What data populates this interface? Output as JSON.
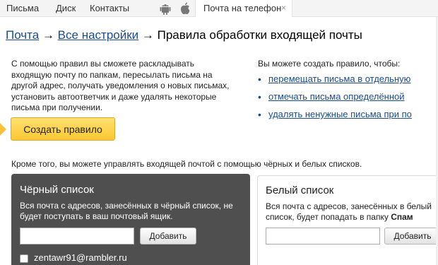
{
  "topnav": {
    "mail": "Письма",
    "disk": "Диск",
    "contacts": "Контакты",
    "phone_tab": "Почта на телефон",
    "close_glyph": "×",
    "icons": [
      "android-icon",
      "apple-icon"
    ]
  },
  "breadcrumb": {
    "mail": "Почта",
    "sep1": " → ",
    "settings": "Все настройки",
    "sep2": " → ",
    "current": "Правила обработки входящей почты"
  },
  "left_desc": "С помощью правил вы сможете раскладывать входящую почту по папкам, пересылать письма на другой адрес, получать уведомления о новых письмах, установить автоответчик и даже удалять некоторые письма при получении.",
  "create_rule_button": "Создать правило",
  "right_intro": "Вы можете создать правило, чтобы:",
  "rule_examples": [
    "перемещать письма в отдельную",
    "отмечать письма определённой",
    "удалять ненужные письма при по"
  ],
  "lists_intro": "Кроме того, вы можете управлять входящей почтой с помощью чёрных и белых списков.",
  "black_list": {
    "title": "Чёрный список",
    "desc": "Вся почта с адресов, занесённых в чёрный список, не будет поступать в ваш почтовый ящик.",
    "input_value": "",
    "add_label": "Добавить",
    "entries": [
      "zentawr91@rambler.ru"
    ]
  },
  "white_list": {
    "title": "Белый список",
    "desc_prefix": "Вся почта с адресов, занесённых в белый список, будет попадать в папку ",
    "desc_folder": "Спам",
    "input_value": "",
    "add_label": "Добавить"
  },
  "colors": {
    "link": "#1a4c8c",
    "accent_button": "#fcc832",
    "black_list_bg": "#4f4f4f"
  }
}
